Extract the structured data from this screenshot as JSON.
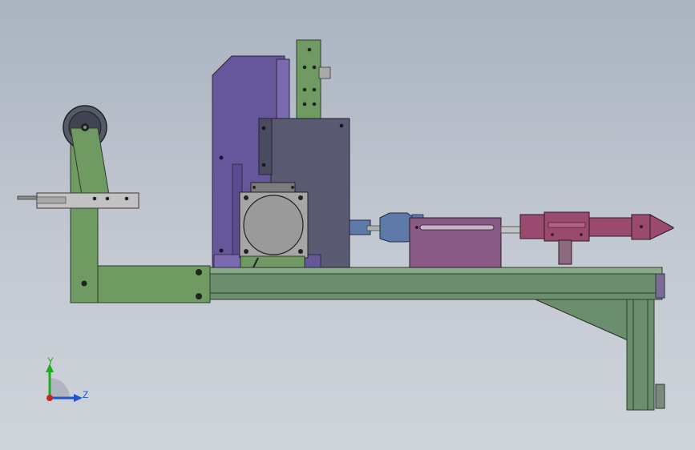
{
  "model_view": {
    "background": [
      "#aab3c1",
      "#cfd3da"
    ],
    "part_colors": {
      "frame": "#6b8f6e",
      "frame_dark": "#5a7d5d",
      "bracket_arm": "#6f9a62",
      "mount_plate": "#66569a",
      "motor_box": "#5a5a73",
      "motor_housing": "#a6a6a6",
      "feed_block": "#8a5a86",
      "nozzle_assembly": "#9a4a6e",
      "coupling": "#5f7aa8",
      "roller": "#55596a"
    }
  },
  "triad": {
    "y_label": "Y",
    "z_label": "Z",
    "y_color": "#22aa22",
    "z_color": "#2255cc",
    "origin_color": "#cc2222"
  }
}
